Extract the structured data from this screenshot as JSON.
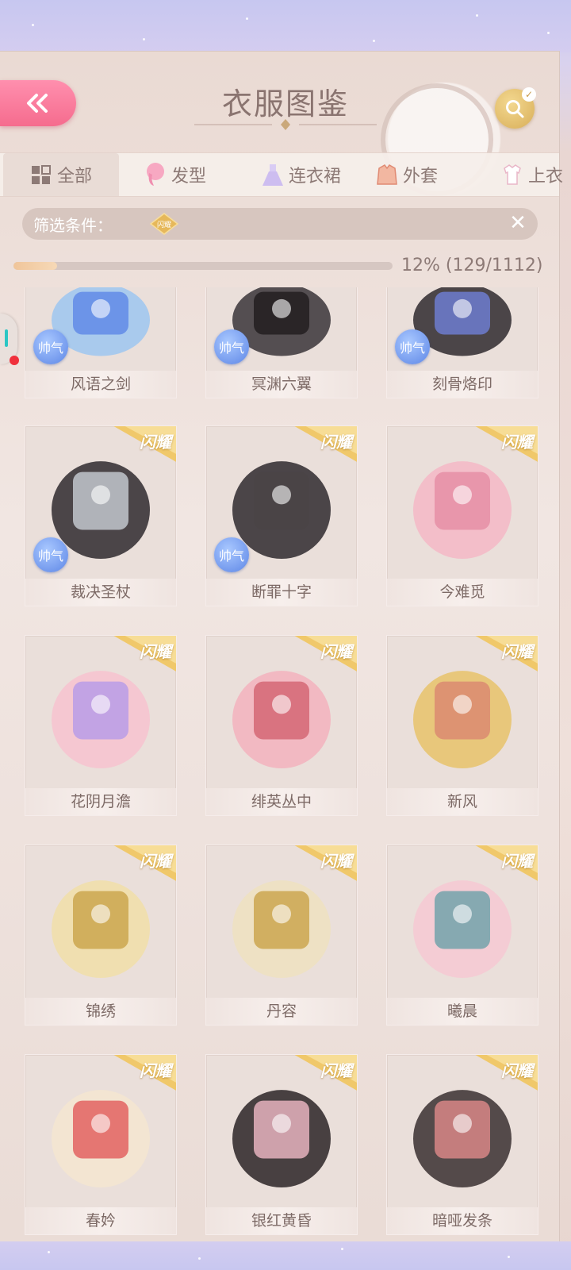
{
  "header": {
    "title": "衣服图鉴"
  },
  "tabs": [
    {
      "label": "全部",
      "icon": "grid-icon"
    },
    {
      "label": "发型",
      "icon": "hair-icon"
    },
    {
      "label": "连衣裙",
      "icon": "dress-icon"
    },
    {
      "label": "外套",
      "icon": "coat-icon"
    },
    {
      "label": "上衣",
      "icon": "shirt-icon"
    }
  ],
  "filter": {
    "label": "筛选条件：",
    "tag": "闪耀"
  },
  "progress": {
    "text": "12% (129/1112)",
    "fraction": 0.116
  },
  "items": [
    {
      "name": "风语之剑",
      "badge": "帅气",
      "ribbon": ""
    },
    {
      "name": "冥渊六翼",
      "badge": "帅气",
      "ribbon": ""
    },
    {
      "name": "刻骨烙印",
      "badge": "帅气",
      "ribbon": ""
    },
    {
      "name": "裁决圣杖",
      "badge": "帅气",
      "ribbon": "闪耀"
    },
    {
      "name": "断罪十字",
      "badge": "帅气",
      "ribbon": "闪耀"
    },
    {
      "name": "今难觅",
      "badge": "",
      "ribbon": "闪耀"
    },
    {
      "name": "花阴月澹",
      "badge": "",
      "ribbon": "闪耀"
    },
    {
      "name": "绯英丛中",
      "badge": "",
      "ribbon": "闪耀"
    },
    {
      "name": "新风",
      "badge": "",
      "ribbon": "闪耀"
    },
    {
      "name": "锦绣",
      "badge": "",
      "ribbon": "闪耀"
    },
    {
      "name": "丹容",
      "badge": "",
      "ribbon": "闪耀"
    },
    {
      "name": "曦晨",
      "badge": "",
      "ribbon": "闪耀"
    },
    {
      "name": "春妗",
      "badge": "",
      "ribbon": "闪耀"
    },
    {
      "name": "银红黄昏",
      "badge": "",
      "ribbon": "闪耀"
    },
    {
      "name": "暗哑发条",
      "badge": "",
      "ribbon": "闪耀"
    }
  ],
  "colors": {
    "accent_pink": "#f56c8e",
    "gold": "#d8ae58",
    "badge_blue": "#5d86e6",
    "text": "#7d6a66"
  }
}
